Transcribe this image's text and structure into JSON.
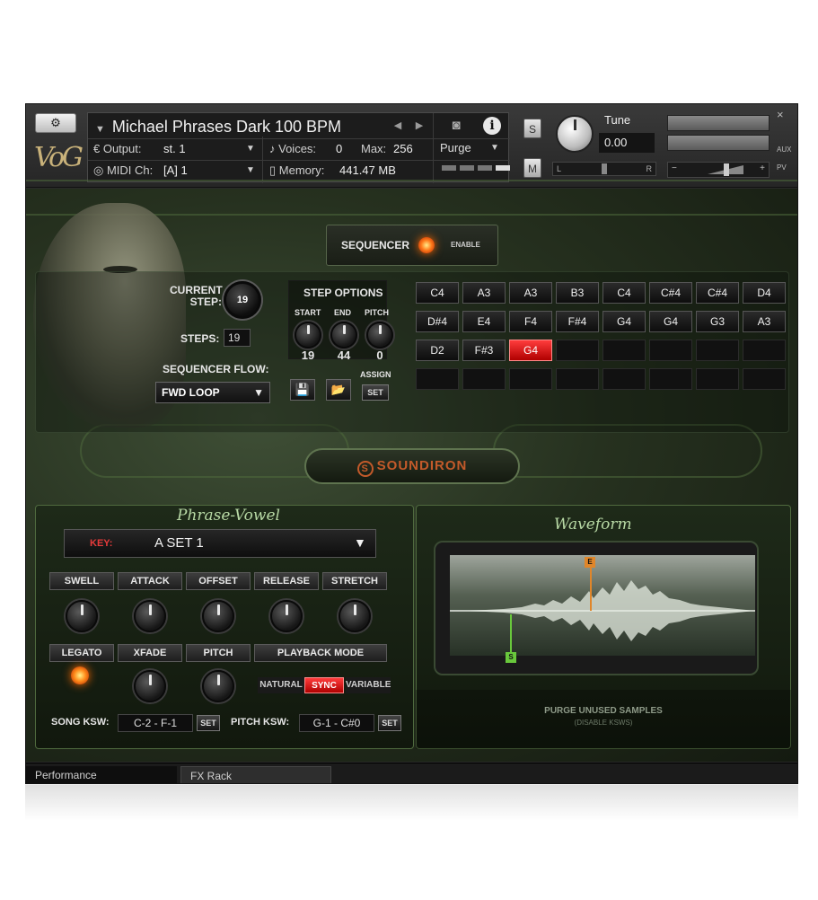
{
  "header": {
    "instrument_name": "Michael Phrases Dark 100 BPM",
    "logo_text": "VoG",
    "output_label": "Output:",
    "output_value": "st. 1",
    "midi_label": "MIDI Ch:",
    "midi_value": "[A]  1",
    "voices_label": "Voices:",
    "voices_value": "0",
    "max_label": "Max:",
    "max_value": "256",
    "memory_label": "Memory:",
    "memory_value": "441.47 MB",
    "purge_label": "Purge",
    "solo_label": "S",
    "mute_label": "M",
    "tune_label": "Tune",
    "tune_value": "0.00",
    "pan_left": "L",
    "pan_right": "R",
    "vol_minus": "−",
    "vol_plus": "+",
    "aux_label": "AUX",
    "pv_label": "PV",
    "close_label": "×"
  },
  "sequencer": {
    "title": "SEQUENCER",
    "enable_label": "ENABLE",
    "current_step_label": "CURRENT\nSTEP:",
    "current_step_value": "19",
    "steps_label": "STEPS:",
    "steps_value": "19",
    "flow_label": "SEQUENCER FLOW:",
    "flow_value": "FWD LOOP",
    "step_options_label": "STEP OPTIONS",
    "start_label": "START",
    "start_value": "19",
    "end_label": "END",
    "end_value": "44",
    "pitch_label": "PITCH",
    "pitch_value": "0",
    "assign_label": "ASSIGN",
    "set_label": "SET",
    "active_index": 18,
    "notes": [
      "C4",
      "A3",
      "A3",
      "B3",
      "C4",
      "C#4",
      "C#4",
      "D4",
      "D#4",
      "E4",
      "F4",
      "F#4",
      "G4",
      "G4",
      "G3",
      "A3",
      "D2",
      "F#3",
      "G4",
      "",
      "",
      "",
      "",
      "",
      "",
      "",
      "",
      "",
      "",
      "",
      "",
      ""
    ]
  },
  "brand": {
    "name": "SOUNDIRON"
  },
  "phrase_vowel": {
    "title": "Phrase-Vowel",
    "key_label": "KEY:",
    "key_value": "A SET 1",
    "knob_labels": [
      "SWELL",
      "ATTACK",
      "OFFSET",
      "RELEASE",
      "STRETCH"
    ],
    "legato_label": "LEGATO",
    "xfade_label": "XFADE",
    "pitch_label": "PITCH",
    "playback_mode_label": "PLAYBACK MODE",
    "modes": [
      "NATURAL",
      "SYNC",
      "VARIABLE"
    ],
    "active_mode": "SYNC",
    "song_ksw_label": "SONG KSW:",
    "song_ksw_value": "C-2 - F-1",
    "pitch_ksw_label": "PITCH KSW:",
    "pitch_ksw_value": "G-1 - C#0",
    "set_label": "SET"
  },
  "waveform": {
    "title": "Waveform",
    "end_marker": "E",
    "start_marker": "S",
    "purge_text": "PURGE UNUSED SAMPLES",
    "purge_sub": "(DISABLE KSWS)"
  },
  "tabs": {
    "performance": "Performance",
    "fx_rack": "FX Rack"
  },
  "colors": {
    "active_red": "#e01c1c",
    "led_orange": "#ff7a1a",
    "accent_green": "#b7d8a4"
  }
}
